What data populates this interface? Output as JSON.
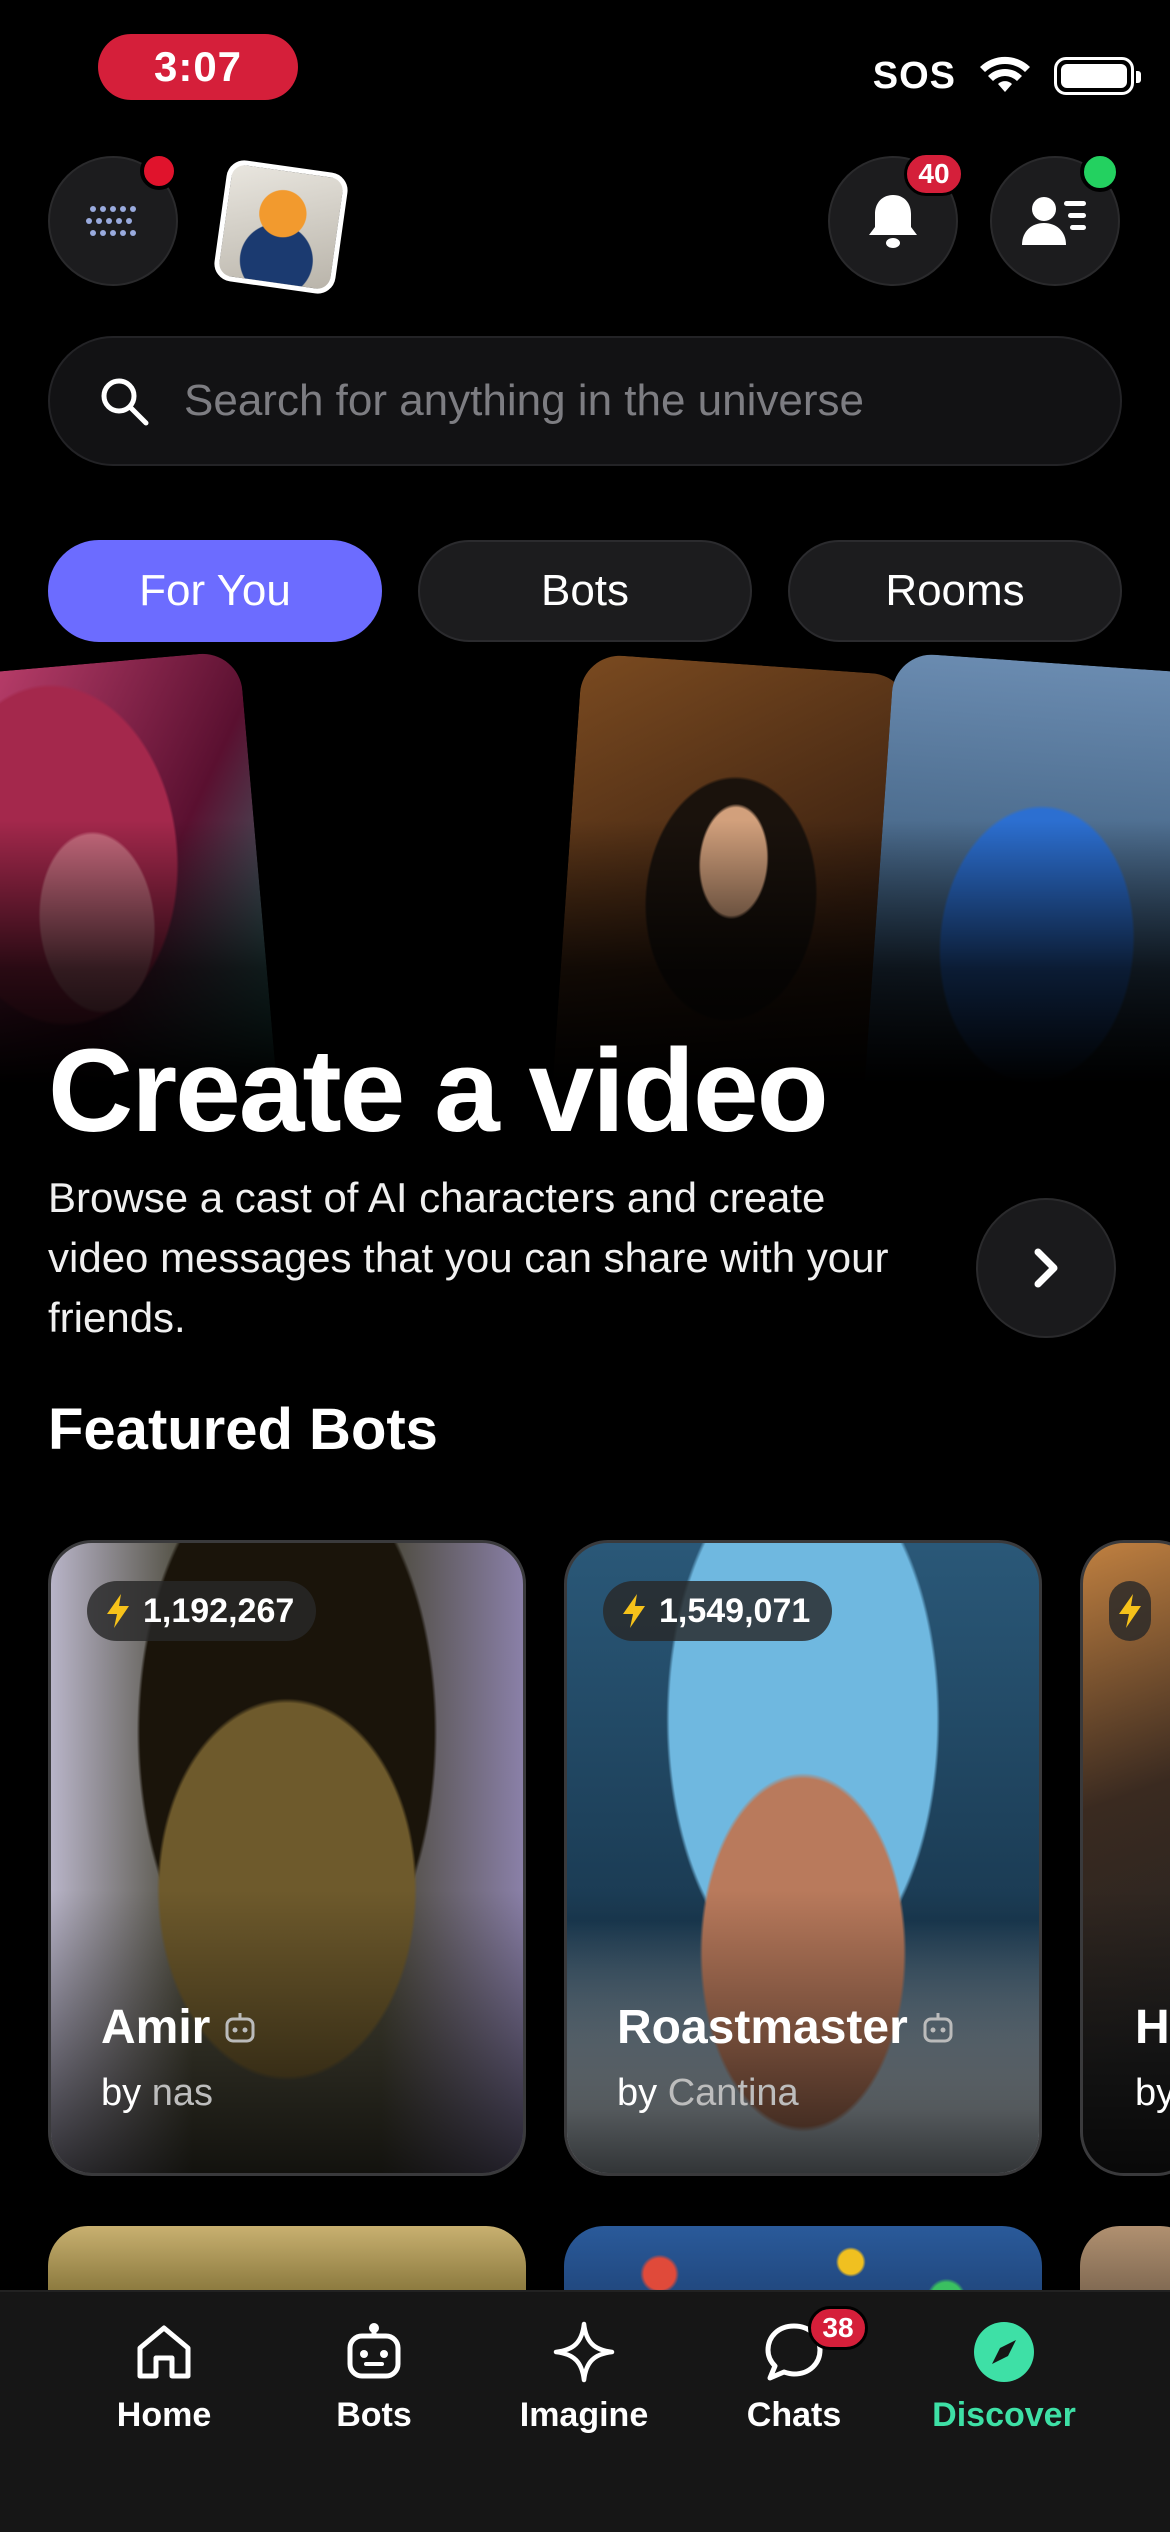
{
  "status_bar": {
    "time": "3:07",
    "carrier": "SOS"
  },
  "header": {
    "notifications_count": "40"
  },
  "search": {
    "placeholder": "Search for anything in the universe"
  },
  "tabs": [
    {
      "label": "For You",
      "active": true
    },
    {
      "label": "Bots",
      "active": false
    },
    {
      "label": "Rooms",
      "active": false
    }
  ],
  "hero": {
    "title": "Create a video",
    "description": "Browse a cast of AI characters and create video messages that you can share with your friends."
  },
  "featured": {
    "title": "Featured Bots",
    "bots": [
      {
        "stat": "1,192,267",
        "name": "Amir",
        "by": "by",
        "author": "nas"
      },
      {
        "stat": "1,549,071",
        "name": "Roastmaster",
        "by": "by",
        "author": "Cantina"
      },
      {
        "stat": "",
        "name": "Ha",
        "by": "by",
        "author": ""
      }
    ]
  },
  "nav": {
    "items": [
      {
        "label": "Home",
        "icon": "home-icon"
      },
      {
        "label": "Bots",
        "icon": "robot-icon"
      },
      {
        "label": "Imagine",
        "icon": "sparkle-icon"
      },
      {
        "label": "Chats",
        "icon": "chat-icon",
        "badge": "38"
      },
      {
        "label": "Discover",
        "icon": "compass-icon",
        "active": true
      }
    ]
  },
  "colors": {
    "accent": "#6c6cff",
    "badge": "#d51f3a",
    "active_nav": "#3ee0a6"
  }
}
